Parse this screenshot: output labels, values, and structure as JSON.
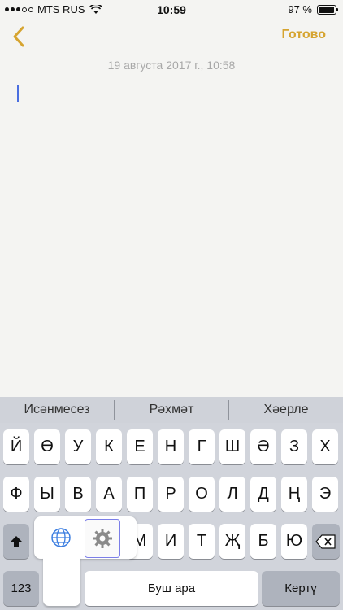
{
  "status_bar": {
    "carrier": "MTS RUS",
    "time": "10:59",
    "battery": "97 %"
  },
  "nav": {
    "done_label": "Готово"
  },
  "note": {
    "date": "19 августа 2017 г., 10:58"
  },
  "suggestions": [
    "Исәнмесез",
    "Рәхмәт",
    "Хәерле"
  ],
  "keyboard": {
    "row1": [
      "Й",
      "Ө",
      "У",
      "К",
      "Е",
      "Н",
      "Г",
      "Ш",
      "Ә",
      "З",
      "Х"
    ],
    "row2": [
      "Ф",
      "Ы",
      "В",
      "А",
      "П",
      "Р",
      "О",
      "Л",
      "Д",
      "Ң",
      "Э"
    ],
    "row3": [
      "М",
      "И",
      "Т",
      "Җ",
      "Б",
      "Ю"
    ],
    "numbers_label": "123",
    "space_label": "Буш ара",
    "return_label": "Кертү"
  },
  "colors": {
    "accent": "#d6a430",
    "caret": "#4a6ee0",
    "keyboard_bg": "#d1d4db"
  }
}
